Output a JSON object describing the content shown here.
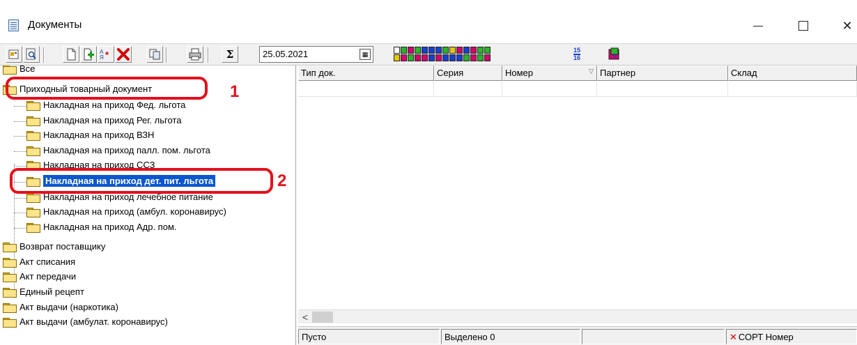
{
  "window": {
    "title": "Документы",
    "controls": {
      "minimize": "—",
      "maximize": "☐",
      "close": "✕"
    }
  },
  "toolbar": {
    "date_value": "25.05.2021",
    "date_button_icon": "calendar-icon",
    "sigma_label": "Σ",
    "calendar_label_top": "15",
    "calendar_label_bottom": "16"
  },
  "tree": {
    "items": [
      {
        "label": "Все"
      },
      {
        "label": "Приходный товарный документ"
      },
      {
        "label": "Накладная на приход Фед. льгота"
      },
      {
        "label": "Накладная на приход Рег. льгота"
      },
      {
        "label": "Накладная на приход ВЗН"
      },
      {
        "label": "Накладная на приход палл. пом. льгота"
      },
      {
        "label": "Накладная на приход ССЗ"
      },
      {
        "label": "Накладная на приход дет. пит. льгота"
      },
      {
        "label": "Накладная на приход лечебное питание"
      },
      {
        "label": "Накладная на приход (амбул. коронавирус)"
      },
      {
        "label": "Накладная на приход Адр. пом."
      },
      {
        "label": "Возврат поставщику"
      },
      {
        "label": "Акт списания"
      },
      {
        "label": "Акт передачи"
      },
      {
        "label": "Единый рецепт"
      },
      {
        "label": "Акт выдачи (наркотика)"
      },
      {
        "label": "Акт выдачи (амбулат. коронавирус)"
      }
    ],
    "annotations": {
      "first": "1",
      "second": "2"
    }
  },
  "grid": {
    "columns": [
      "Тип док.",
      "Серия",
      "Номер",
      "Партнер",
      "Склад"
    ],
    "scroll_left": "<"
  },
  "status": {
    "state": "Пусто",
    "selected": "Выделено 0",
    "sort": "СОРТ Номер"
  },
  "colors": {
    "selection": "#0a56d0",
    "annotation": "#e3101c",
    "folder": "#fbe48a"
  }
}
